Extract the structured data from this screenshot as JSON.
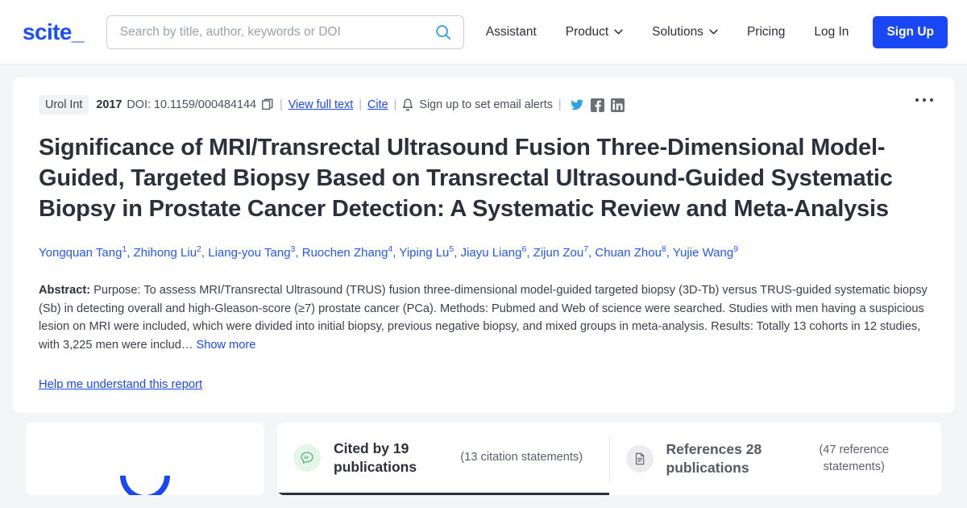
{
  "header": {
    "logo": "scite_",
    "search": {
      "placeholder": "Search by title, author, keywords or DOI",
      "value": "",
      "icon": "search-icon"
    },
    "nav": [
      {
        "label": "Assistant",
        "has_caret": false
      },
      {
        "label": "Product",
        "has_caret": true
      },
      {
        "label": "Solutions",
        "has_caret": true
      },
      {
        "label": "Pricing",
        "has_caret": false
      },
      {
        "label": "Log In",
        "has_caret": false
      }
    ],
    "signup_label": "Sign Up",
    "accent_color": "#1a47f5"
  },
  "article": {
    "journal": "Urol Int",
    "year": "2017",
    "doi_label": "DOI: 10.1159/000484144",
    "copy_icon": "copy-icon",
    "view_full_text": "View full text",
    "cite": "Cite",
    "bell_icon": "bell-icon",
    "email_alerts": "Sign up to set email alerts",
    "social": [
      "twitter-icon",
      "facebook-icon",
      "linkedin-icon"
    ],
    "separator": "|",
    "overflow_menu": "more-options",
    "title": "Significance of MRI/Transrectal Ultrasound Fusion Three-Dimensional Model-Guided, Targeted Biopsy Based on Transrectal Ultrasound-Guided Systematic Biopsy in Prostate Cancer Detection: A Systematic Review and Meta-Analysis",
    "authors": [
      {
        "name": "Yongquan Tang",
        "sup": "1"
      },
      {
        "name": "Zhihong Liu",
        "sup": "2"
      },
      {
        "name": "Liang-you Tang",
        "sup": "3"
      },
      {
        "name": "Ruochen Zhang",
        "sup": "4"
      },
      {
        "name": "Yiping Lu",
        "sup": "5"
      },
      {
        "name": "Jiayu Liang",
        "sup": "6"
      },
      {
        "name": "Zijun Zou",
        "sup": "7"
      },
      {
        "name": "Chuan Zhou",
        "sup": "8"
      },
      {
        "name": "Yujie Wang",
        "sup": "9"
      }
    ],
    "abstract_label": "Abstract:",
    "abstract_text": " Purpose: To assess MRI/Transrectal Ultrasound (TRUS) fusion three-dimensional model-guided targeted biopsy (3D-Tb) versus TRUS-guided systematic biopsy (Sb) in detecting overall and high-Gleason-score (≥7) prostate cancer (PCa). Methods: Pubmed and Web of science were searched. Studies with men having a suspicious lesion on MRI were included, which were divided into initial biopsy, previous negative biopsy, and mixed groups in meta-analysis. Results: Totally 13 cohorts in 12 studies, with 3,225 men were includ… ",
    "show_more": "Show more",
    "help_link": "Help me understand this report"
  },
  "bottom": {
    "spinner": "loading-spinner",
    "tabs": [
      {
        "icon": "citation-quote-icon",
        "title": "Cited by 19 publications",
        "subtitle": "(13 citation statements)",
        "active": true
      },
      {
        "icon": "references-document-icon",
        "title": "References 28 publications",
        "subtitle": "(47 reference statements)",
        "active": false
      }
    ]
  }
}
